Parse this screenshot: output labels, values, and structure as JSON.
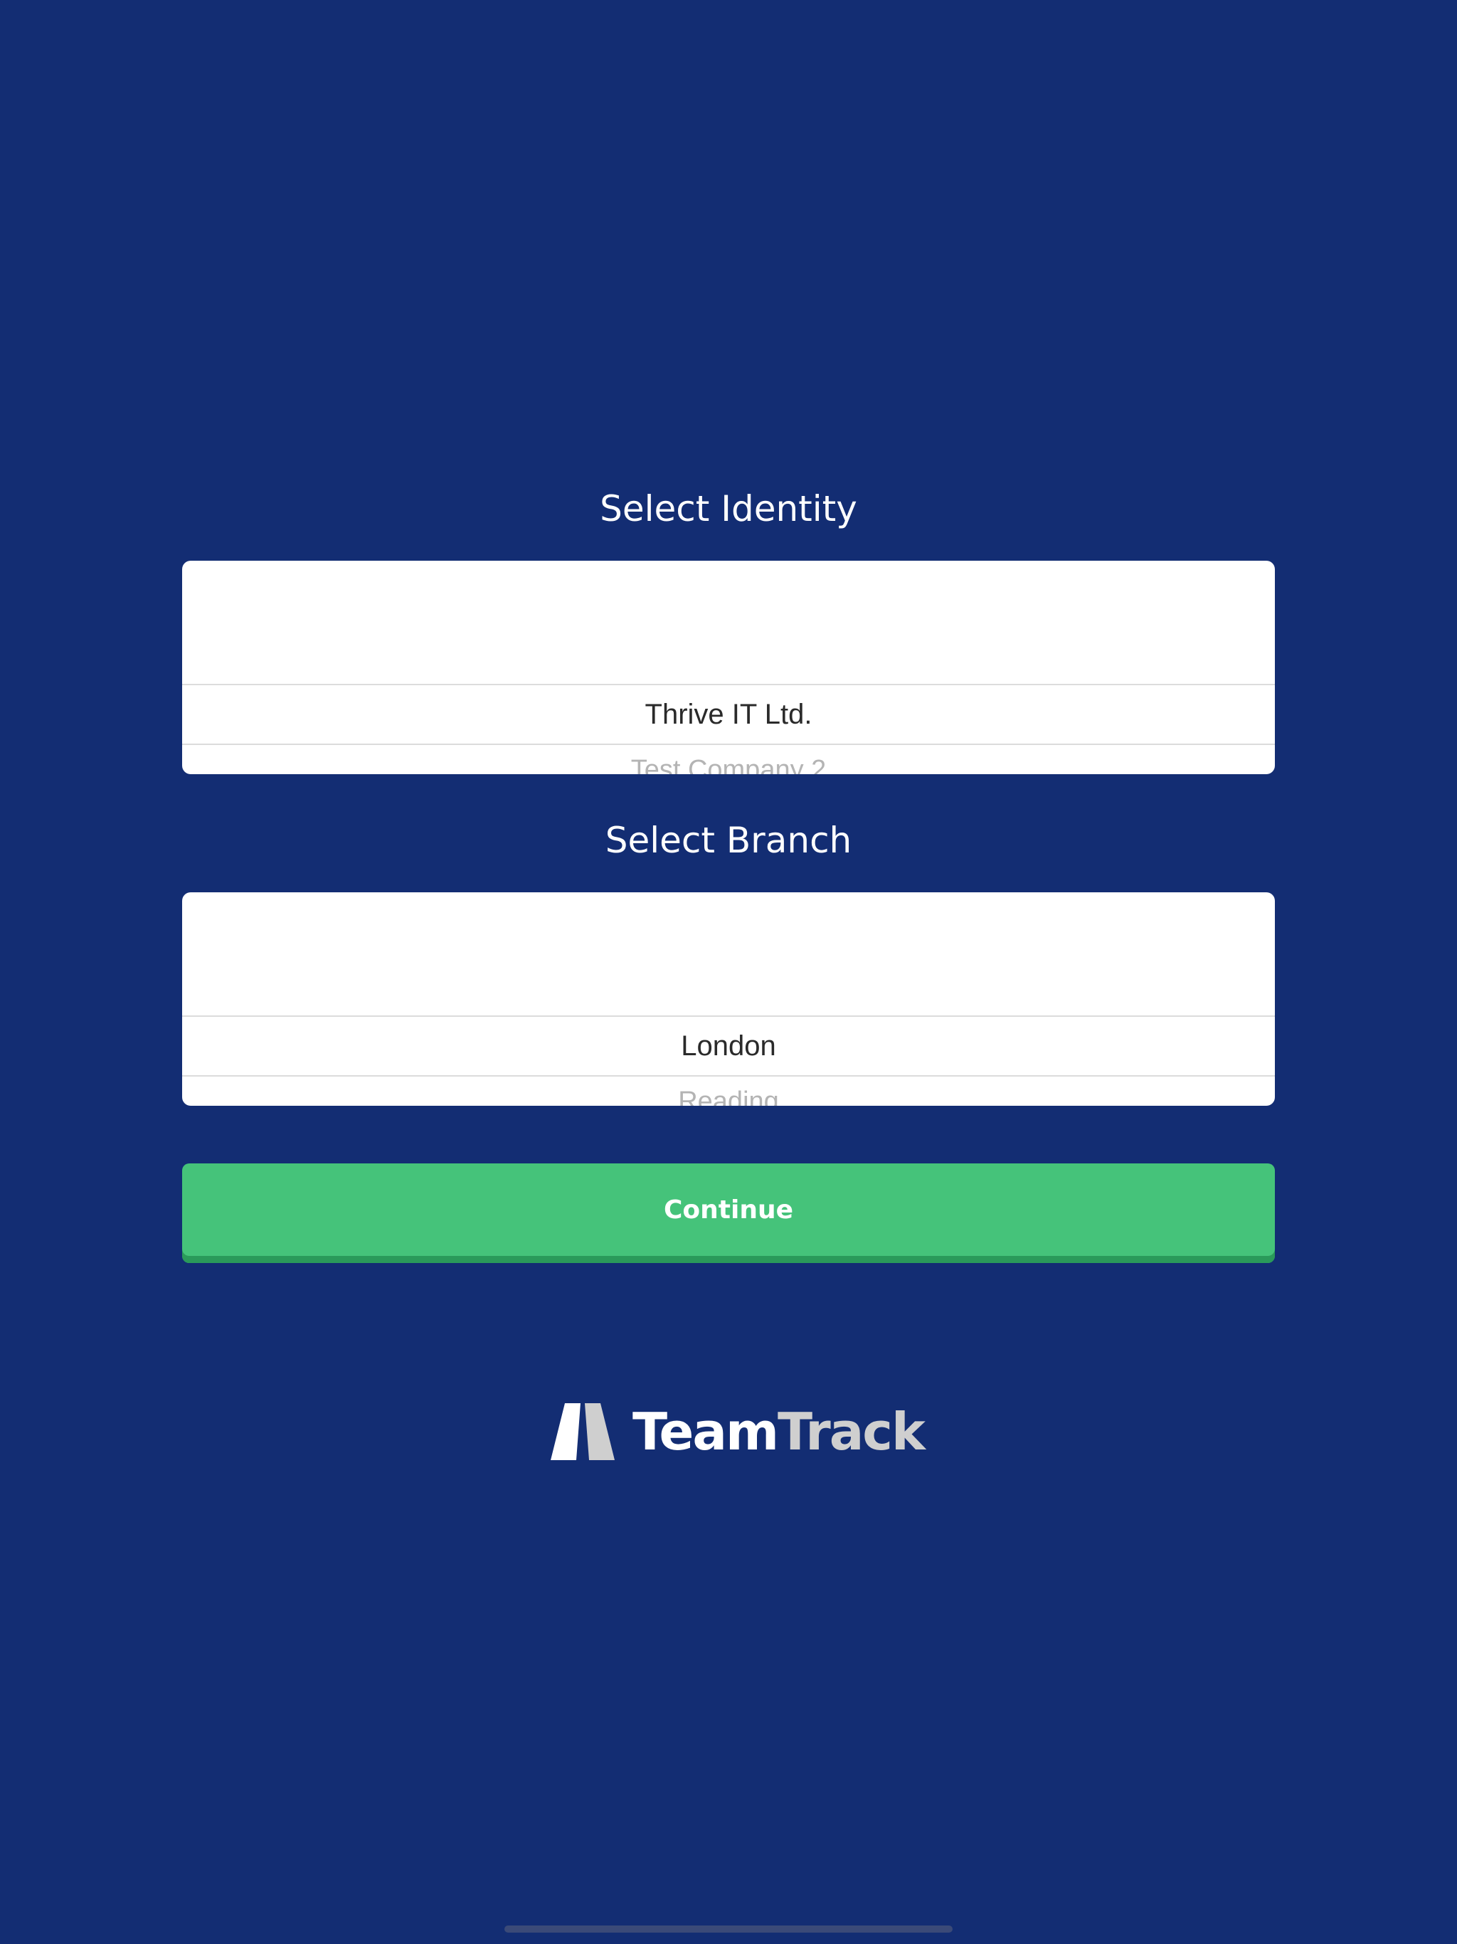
{
  "identity": {
    "title": "Select Identity",
    "selected": "Thrive IT Ltd.",
    "next_option": "Test Company 2"
  },
  "branch": {
    "title": "Select Branch",
    "selected": "London",
    "next_option": "Reading"
  },
  "actions": {
    "continue_label": "Continue"
  },
  "brand": {
    "name_part1": "Team",
    "name_part2": "Track"
  },
  "colors": {
    "background": "#132d73",
    "button": "#45c37a",
    "button_shadow": "#2a9a5a",
    "picker_background": "#ffffff"
  }
}
